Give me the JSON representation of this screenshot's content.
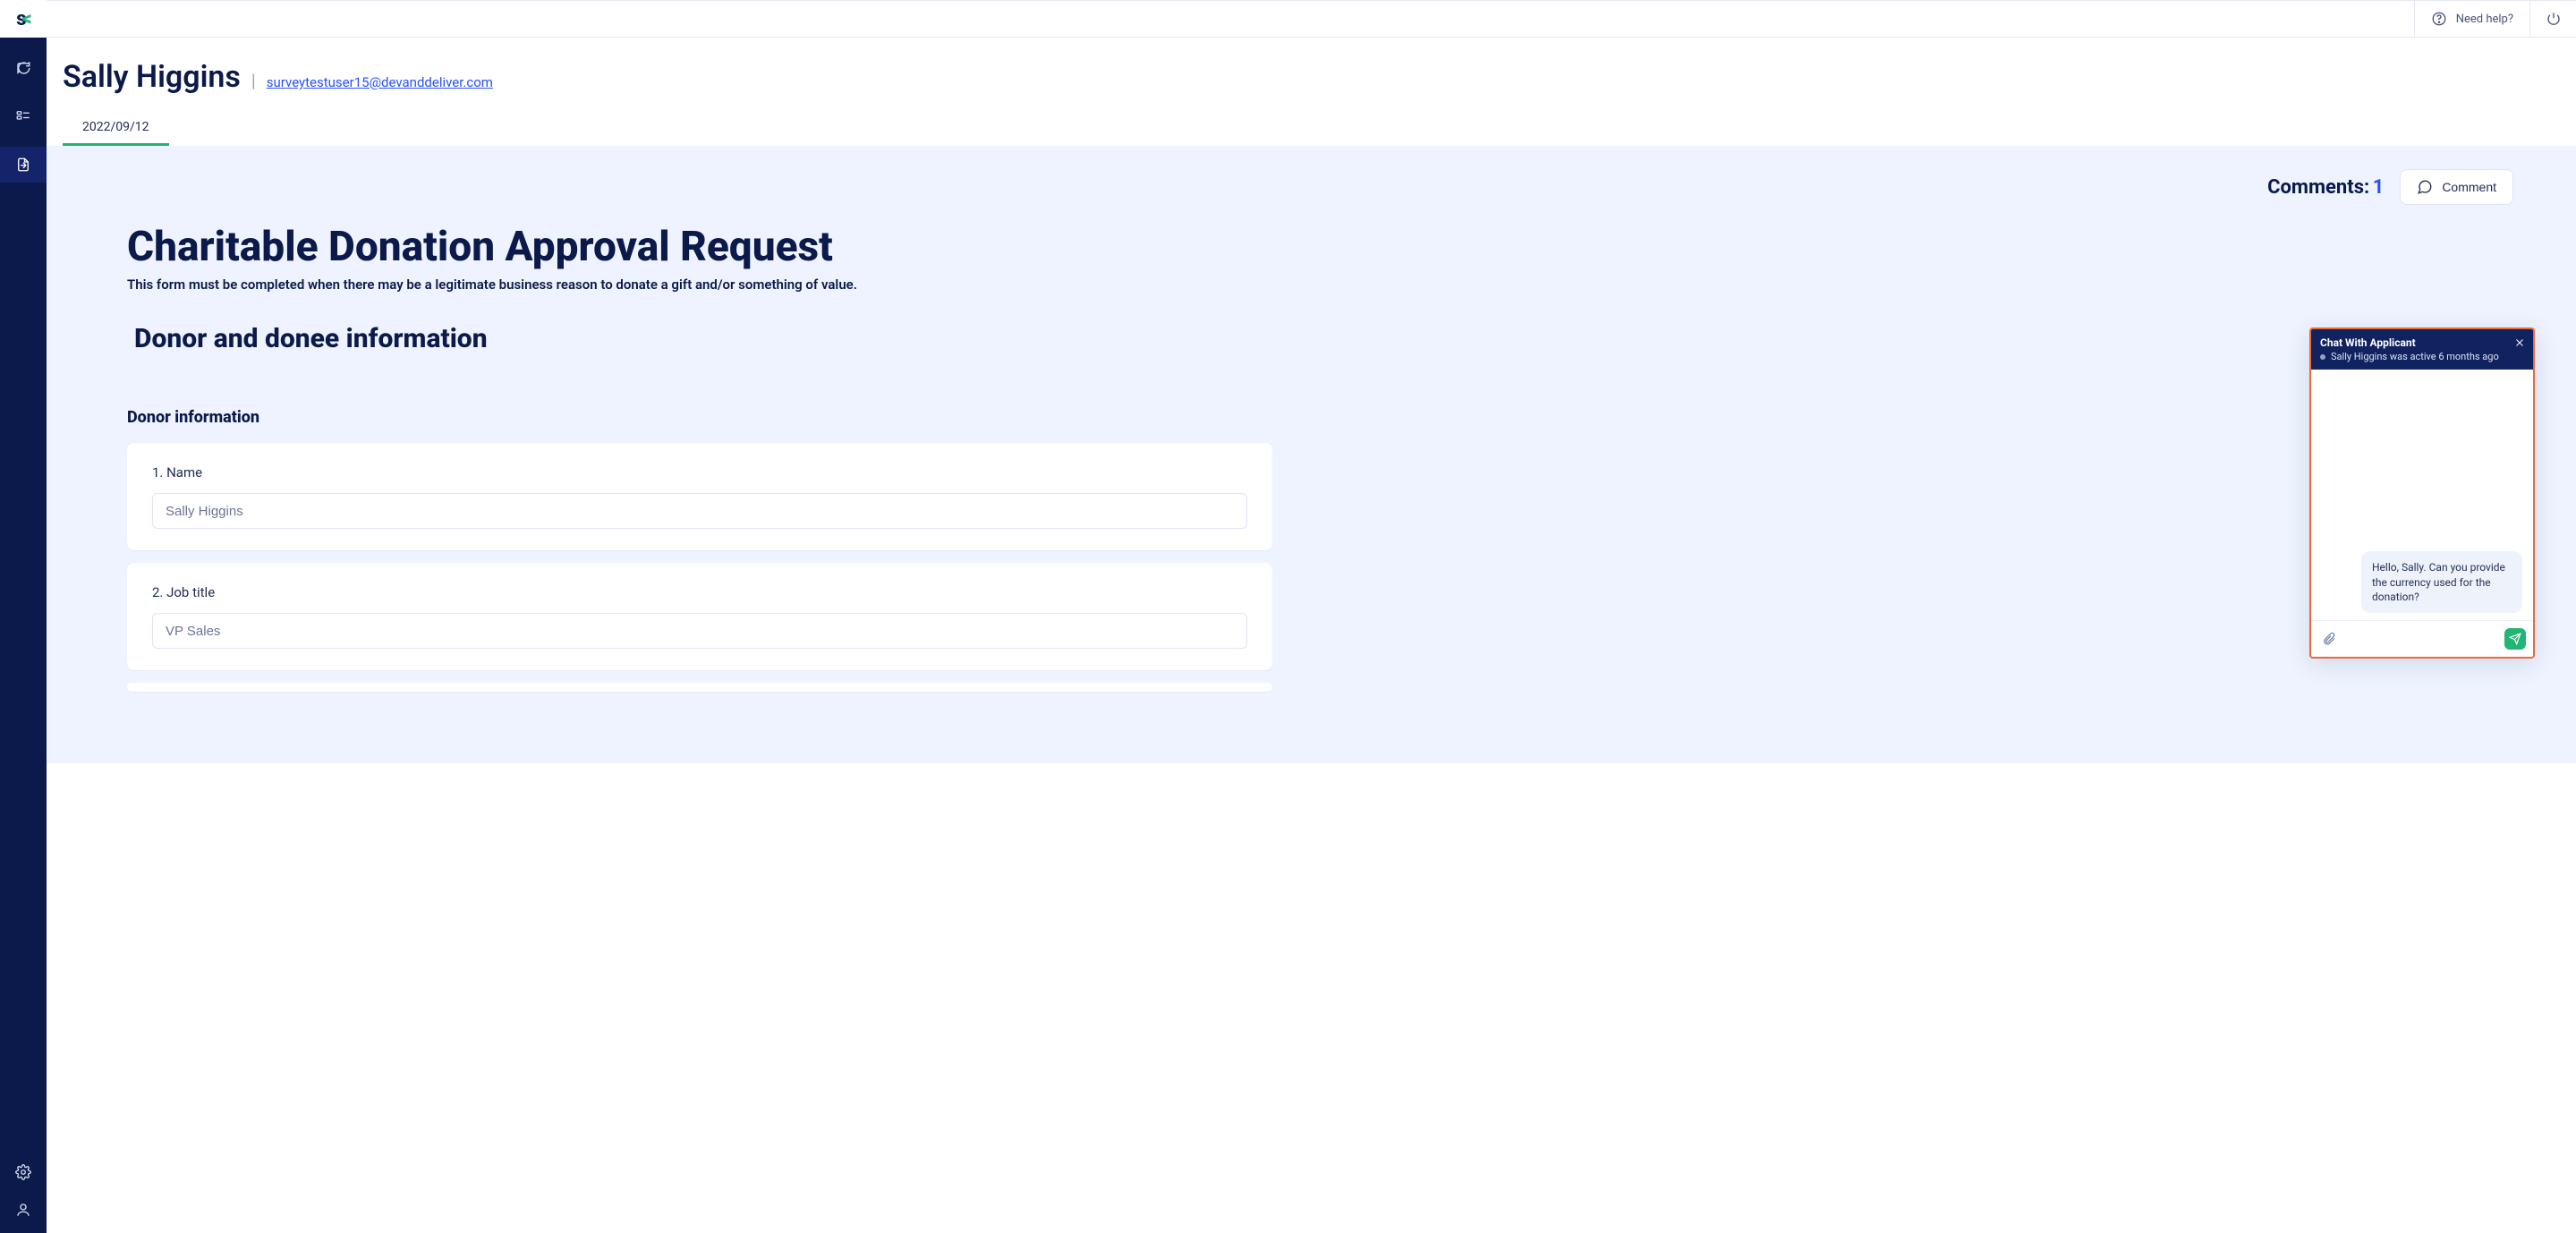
{
  "colors": {
    "navy": "#0b1a4a",
    "accent": "#22b573",
    "link": "#2851ff",
    "chat_border": "#e86a3a"
  },
  "topbar": {
    "help_label": "Need help?"
  },
  "sidebar": {
    "logo_primary": "s",
    "logo_accent": "<",
    "items": [
      {
        "name": "chat-icon"
      },
      {
        "name": "list-icon"
      },
      {
        "name": "file-export-icon"
      }
    ],
    "bottom_items": [
      {
        "name": "gear-icon"
      },
      {
        "name": "user-icon"
      }
    ]
  },
  "header": {
    "title": "Sally Higgins",
    "email": "surveytestuser15@devanddeliver.com",
    "tabs": [
      {
        "label": "2022/09/12"
      }
    ]
  },
  "comments": {
    "label": "Comments:",
    "count": "1",
    "button_label": "Comment"
  },
  "form": {
    "title": "Charitable Donation Approval Request",
    "subtitle": "This form must be completed when there may be a legitimate business reason to donate a gift and/or something of value.",
    "section_title": "Donor and donee information",
    "subsection_title": "Donor information",
    "fields": [
      {
        "label": "1. Name",
        "value": "Sally Higgins"
      },
      {
        "label": "2. Job title",
        "value": "VP Sales"
      }
    ]
  },
  "chat": {
    "title": "Chat With Applicant",
    "status": "Sally Higgins was active 6 months ago",
    "message": "Hello, Sally. Can you provide the currency used for the donation?"
  }
}
